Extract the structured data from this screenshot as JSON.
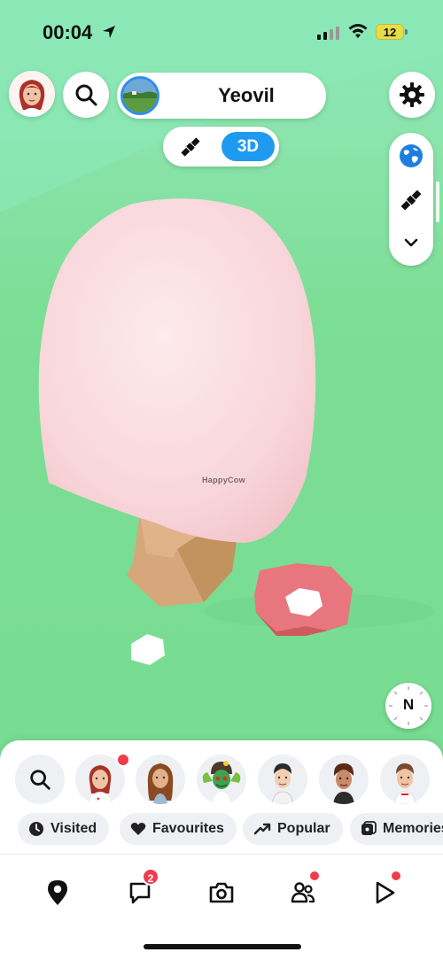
{
  "status_bar": {
    "time": "00:04",
    "battery": "12",
    "icons": [
      "location-arrow-icon",
      "cellular-signal-icon",
      "wifi-icon",
      "battery-icon"
    ]
  },
  "header": {
    "location_name": "Yeovil",
    "view_mode_selected": "3D",
    "icons": [
      "profile-avatar",
      "search-icon",
      "location-thumbnail",
      "settings-gear-icon"
    ]
  },
  "view_toggle": {
    "option_satellite": "satellite-icon",
    "option_3d": "3D"
  },
  "layers": {
    "items": [
      "globe-icon",
      "satellite-icon",
      "chevron-down-icon"
    ]
  },
  "map": {
    "watermark": "HappyCow"
  },
  "compass": {
    "letter": "N"
  },
  "friends": {
    "count": 7,
    "unread_dots": [
      true,
      false,
      false,
      false,
      false,
      false
    ]
  },
  "chips": [
    {
      "label": "Visited",
      "icon": "clock-icon"
    },
    {
      "label": "Favourites",
      "icon": "heart-icon"
    },
    {
      "label": "Popular",
      "icon": "trending-up-icon"
    },
    {
      "label": "Memories",
      "icon": "memories-icon"
    }
  ],
  "nav": {
    "items": [
      {
        "icon": "map-pin-icon",
        "badge": ""
      },
      {
        "icon": "chat-icon",
        "badge": "2"
      },
      {
        "icon": "camera-icon",
        "badge": ""
      },
      {
        "icon": "friends-icon",
        "badge": "dot"
      },
      {
        "icon": "spotlight-icon",
        "badge": "dot"
      }
    ]
  },
  "colors": {
    "accent_blue": "#1e9bf0",
    "notification_red": "#f03b4c",
    "map_green": "#7dde96",
    "ice_cream_pink": "#f6d0d6"
  }
}
